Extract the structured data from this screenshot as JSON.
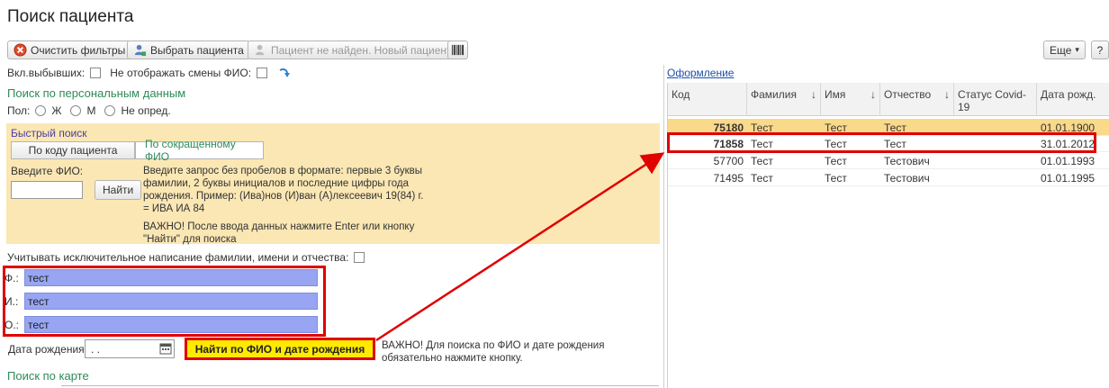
{
  "page": {
    "title": "Поиск пациента"
  },
  "toolbar": {
    "clear_filters": "Очистить фильтры",
    "select_patient": "Выбрать пациента",
    "new_patient": "Пациент не найден. Новый пациент",
    "more": "Еще",
    "more_arrow": "▾",
    "help": "?"
  },
  "options": {
    "include_deceased": "Вкл.выбывших:",
    "hide_fio_changes": "Не отображать смены ФИО:"
  },
  "personal": {
    "heading": "Поиск по персональным данным",
    "gender_label": "Пол:",
    "gender_options": [
      "Ж",
      "М",
      "Не опред."
    ]
  },
  "quick": {
    "label": "Быстрый поиск",
    "tabs": [
      "По коду пациента",
      "По сокращенному ФИО"
    ],
    "fio_label": "Введите ФИО:",
    "fio_value": "",
    "find_button": "Найти",
    "hint1": "Введите запрос без пробелов в формате: первые 3 буквы фамилии, 2 буквы инициалов и последние цифры года рождения. Пример: (Ива)нов (И)ван (А)лексеевич 19(84) г. = ИВА ИА 84",
    "hint2": "ВАЖНО! После ввода данных нажмите Enter или кнопку \"Найти\" для поиска"
  },
  "exact": {
    "label": "Учитывать исключительное написание фамилии, имени и отчества:"
  },
  "fields": {
    "surname_label": "Ф.:",
    "surname_value": "тест",
    "name_label": "И.:",
    "name_value": "тест",
    "patronymic_label": "О.:",
    "patronymic_value": "тест"
  },
  "dob": {
    "label": "Дата рождения:",
    "value": ". ."
  },
  "search_fio_dob": "Найти по ФИО и дате рождения",
  "warning": "ВАЖНО! Для поиска по ФИО и дате рождения обязательно нажмите кнопку.",
  "card": {
    "heading": "Поиск по  карте"
  },
  "right": {
    "design_link": "Оформление"
  },
  "grid": {
    "columns": [
      "Код",
      "Фамилия",
      "Имя",
      "Отчество",
      "Статус Covid-19",
      "Дата рожд."
    ],
    "sort_arrow": "↓",
    "rows": [
      {
        "code": "75180",
        "surname": "Тест",
        "name": "Тест",
        "patronymic": "Тест",
        "covid": "",
        "dob": "01.01.1900"
      },
      {
        "code": "71858",
        "surname": "Тест",
        "name": "Тест",
        "patronymic": "Тест",
        "covid": "",
        "dob": "31.01.2012"
      },
      {
        "code": "57700",
        "surname": "Тест",
        "name": "Тест",
        "patronymic": "Тестович",
        "covid": "",
        "dob": "01.01.1993"
      },
      {
        "code": "71495",
        "surname": "Тест",
        "name": "Тест",
        "patronymic": "Тестович",
        "covid": "",
        "dob": "01.01.1995"
      }
    ]
  },
  "colors": {
    "highlight_red": "#e00000",
    "selected_row": "#f9d98a",
    "quick_bg": "#fbe7b4",
    "field_bg": "#97a5f2",
    "button_yellow": "#ffea00",
    "green_heading": "#2e8b57"
  }
}
